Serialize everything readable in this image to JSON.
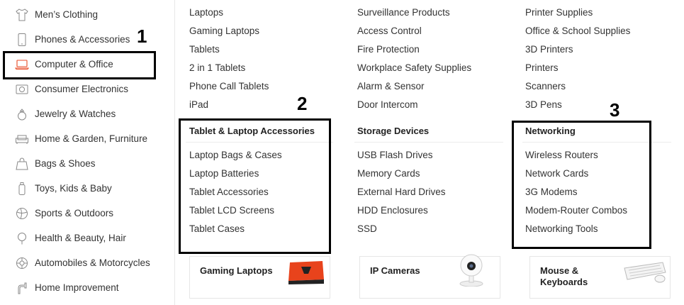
{
  "sidebar": {
    "items": [
      {
        "label": "Men’s Clothing",
        "icon": "shirt-icon"
      },
      {
        "label": "Phones & Accessories",
        "icon": "phone-icon"
      },
      {
        "label": "Computer & Office",
        "icon": "laptop-icon",
        "active": true
      },
      {
        "label": "Consumer Electronics",
        "icon": "camera-icon"
      },
      {
        "label": "Jewelry & Watches",
        "icon": "ring-icon"
      },
      {
        "label": "Home & Garden, Furniture",
        "icon": "sofa-icon"
      },
      {
        "label": "Bags & Shoes",
        "icon": "bag-icon"
      },
      {
        "label": "Toys, Kids & Baby",
        "icon": "bottle-icon"
      },
      {
        "label": "Sports & Outdoors",
        "icon": "ball-icon"
      },
      {
        "label": "Health & Beauty, Hair",
        "icon": "mirror-icon"
      },
      {
        "label": "Automobiles & Motorcycles",
        "icon": "wheel-icon"
      },
      {
        "label": "Home Improvement",
        "icon": "tool-icon"
      }
    ]
  },
  "menu": {
    "col1_top": [
      "Laptops",
      "Gaming Laptops",
      "Tablets",
      "2 in 1 Tablets",
      "Phone Call Tablets",
      "iPad"
    ],
    "col2_top": [
      "Surveillance Products",
      "Access Control",
      "Fire Protection",
      "Workplace Safety Supplies",
      "Alarm & Sensor",
      "Door Intercom"
    ],
    "col3_top": [
      "Printer Supplies",
      "Office & School Supplies",
      "3D Printers",
      "Printers",
      "Scanners",
      "3D Pens"
    ],
    "col1_heading": "Tablet & Laptop Accessories",
    "col2_heading": "Storage Devices",
    "col3_heading": "Networking",
    "col1_bottom": [
      "Laptop Bags & Cases",
      "Laptop Batteries",
      "Tablet Accessories",
      "Tablet LCD Screens",
      "Tablet Cases"
    ],
    "col2_bottom": [
      "USB Flash Drives",
      "Memory Cards",
      "External Hard Drives",
      "HDD Enclosures",
      "SSD"
    ],
    "col3_bottom": [
      "Wireless Routers",
      "Network Cards",
      "3G Modems",
      "Modem-Router Combos",
      "Networking Tools"
    ]
  },
  "annotations": {
    "one": "1",
    "two": "2",
    "three": "3"
  },
  "cards": [
    {
      "title": "Gaming Laptops"
    },
    {
      "title": "IP Cameras"
    },
    {
      "title_line1": "Mouse &",
      "title_line2": "Keyboards"
    }
  ],
  "colors": {
    "accent": "#e84a24"
  }
}
